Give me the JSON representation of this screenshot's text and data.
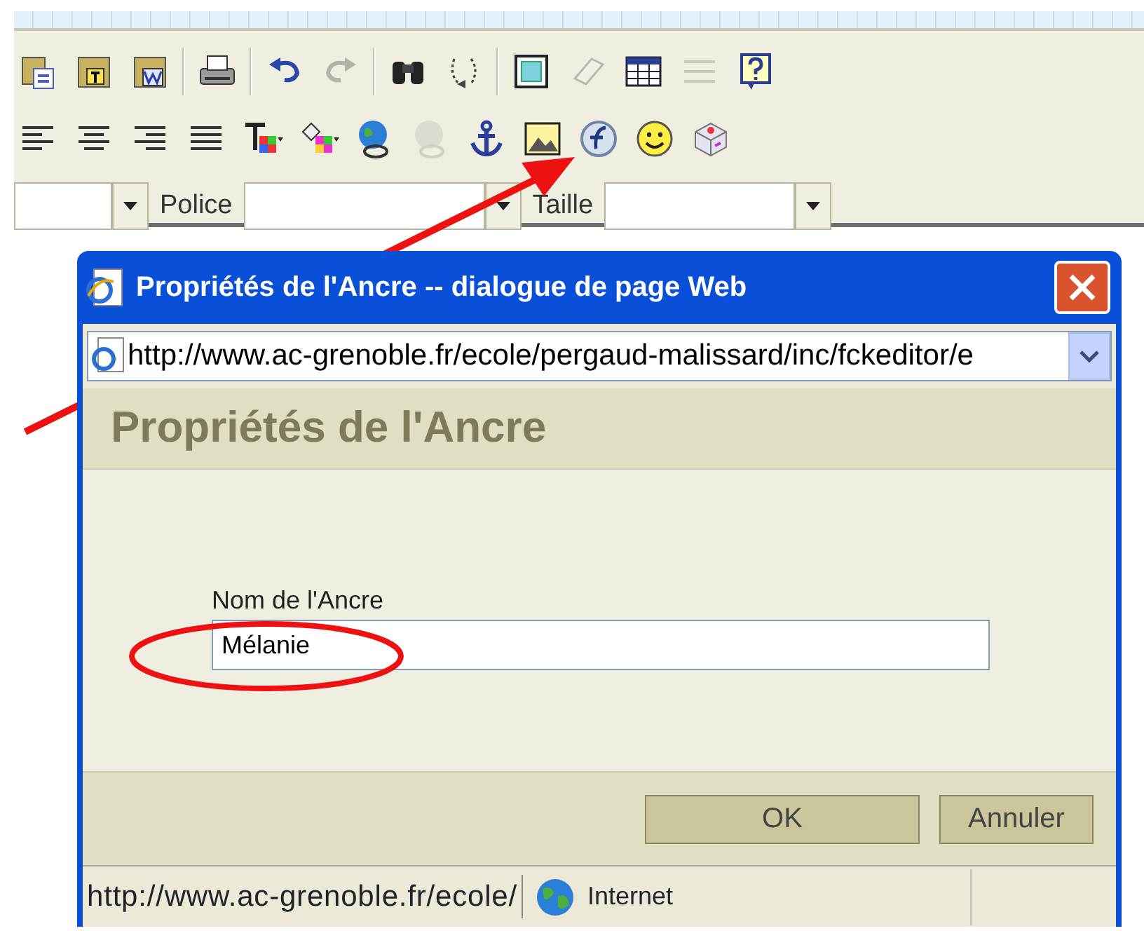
{
  "toolbar": {
    "rows": [
      [
        {
          "kind": "paste",
          "disabled": false
        },
        {
          "kind": "paste-text",
          "disabled": false
        },
        {
          "kind": "paste-word",
          "disabled": false
        },
        {
          "kind": "separator"
        },
        {
          "kind": "print",
          "disabled": false
        },
        {
          "kind": "separator"
        },
        {
          "kind": "undo",
          "disabled": false
        },
        {
          "kind": "redo",
          "disabled": true
        },
        {
          "kind": "separator"
        },
        {
          "kind": "find",
          "disabled": false
        },
        {
          "kind": "replace",
          "disabled": false
        },
        {
          "kind": "separator"
        },
        {
          "kind": "select-all",
          "disabled": false
        },
        {
          "kind": "eraser",
          "disabled": true
        },
        {
          "kind": "table",
          "disabled": false
        },
        {
          "kind": "rule",
          "disabled": true
        },
        {
          "kind": "help",
          "disabled": false
        }
      ],
      [
        {
          "kind": "align-left",
          "disabled": false
        },
        {
          "kind": "align-center",
          "disabled": false
        },
        {
          "kind": "align-right",
          "disabled": false
        },
        {
          "kind": "justify",
          "disabled": false
        },
        {
          "kind": "text-color",
          "disabled": false
        },
        {
          "kind": "fill-color",
          "disabled": false
        },
        {
          "kind": "link",
          "disabled": false
        },
        {
          "kind": "unlink",
          "disabled": true
        },
        {
          "kind": "anchor",
          "disabled": false
        },
        {
          "kind": "image",
          "disabled": false
        },
        {
          "kind": "flash",
          "disabled": false
        },
        {
          "kind": "smiley",
          "disabled": false
        },
        {
          "kind": "special-char",
          "disabled": false
        }
      ]
    ],
    "combos": [
      {
        "label": "Police"
      },
      {
        "label": "Taille"
      }
    ]
  },
  "dialog": {
    "title": "Propriétés de l'Ancre -- dialogue de page Web",
    "address": "http://www.ac-grenoble.fr/ecole/pergaud-malissard/inc/fckeditor/e",
    "heading": "Propriétés de l'Ancre",
    "field": {
      "label": "Nom de l'Ancre",
      "value": "Mélanie"
    },
    "buttons": [
      "OK",
      "Annuler"
    ],
    "status_bar": {
      "url": "http://www.ac-grenoble.fr/ecole/",
      "zone": "Internet"
    }
  }
}
